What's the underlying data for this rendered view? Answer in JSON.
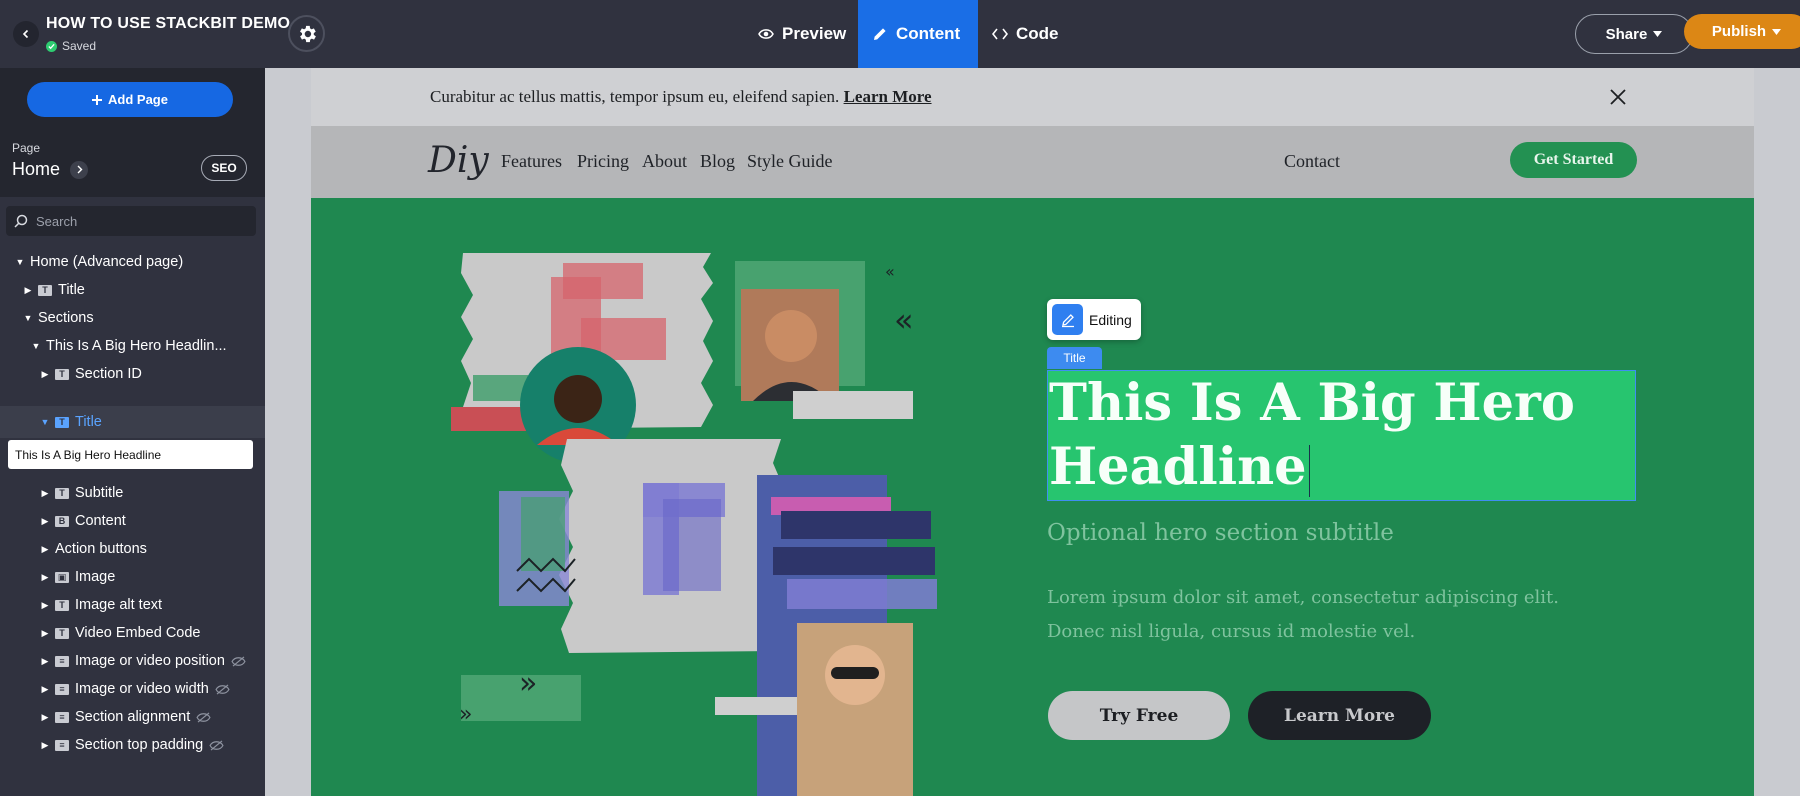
{
  "topbar": {
    "project_title": "HOW TO USE STACKBIT DEMO",
    "save_status": "Saved",
    "tabs": [
      {
        "label": "Preview",
        "active": false
      },
      {
        "label": "Content",
        "active": true
      },
      {
        "label": "Code",
        "active": false
      }
    ],
    "share_label": "Share",
    "publish_label": "Publish",
    "colors": {
      "bar": "#30323f",
      "active_tab": "#1a6ee6",
      "publish": "#dc8715"
    }
  },
  "sidebar": {
    "add_page_label": "Add Page",
    "page_label": "Page",
    "page_name": "Home",
    "seo_label": "SEO",
    "search_placeholder": "Search",
    "tree": {
      "root": "Home (Advanced page)",
      "title": "Title",
      "sections": "Sections",
      "hero_section": "This Is A Big Hero Headlin...",
      "section_id": "Section ID",
      "hero_title": "Title",
      "hero_title_value": "This Is A Big Hero Headline",
      "subtitle": "Subtitle",
      "content": "Content",
      "action_buttons": "Action buttons",
      "image": "Image",
      "image_alt": "Image alt text",
      "video_embed": "Video Embed Code",
      "media_position": "Image or video position",
      "media_width": "Image or video width",
      "section_alignment": "Section alignment",
      "section_top_padding": "Section top padding"
    }
  },
  "site": {
    "promo": {
      "text": "Curabitur ac tellus mattis, tempor ipsum eu, eleifend sapien.",
      "link": "Learn More"
    },
    "logo": "Diy",
    "nav": [
      "Features",
      "Pricing",
      "About",
      "Blog",
      "Style Guide"
    ],
    "contact": "Contact",
    "get_started": "Get Started",
    "editing_label": "Editing",
    "field_tag": "Title",
    "hero": {
      "title_line1": "This Is A Big Hero",
      "title_line2": "Headline",
      "subtitle": "Optional hero section subtitle",
      "body_line1": "Lorem ipsum dolor sit amet, consectetur adipiscing elit.",
      "body_line2": "Donec nisl ligula, cursus id molestie vel.",
      "primary_button": "Try Free",
      "secondary_button": "Learn More"
    },
    "colors": {
      "hero_bg": "#1f8850",
      "title_highlight": "#27c56f",
      "accent_button": "#239152"
    }
  }
}
